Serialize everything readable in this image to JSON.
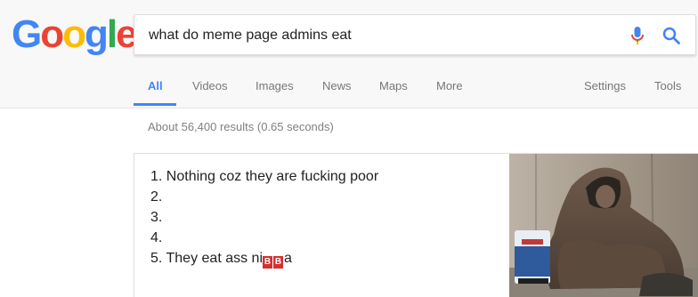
{
  "logo": {
    "letters": [
      "G",
      "o",
      "o",
      "g",
      "l",
      "e"
    ]
  },
  "search": {
    "query": "what do meme page admins eat",
    "mic_icon": "microphone-icon",
    "search_icon": "search-icon"
  },
  "tabs": [
    {
      "label": "All",
      "active": true
    },
    {
      "label": "Videos",
      "active": false
    },
    {
      "label": "Images",
      "active": false
    },
    {
      "label": "News",
      "active": false
    },
    {
      "label": "Maps",
      "active": false
    },
    {
      "label": "More",
      "active": false
    }
  ],
  "tools": {
    "settings": "Settings",
    "tools": "Tools"
  },
  "result_stats": "About 56,400 results (0.65 seconds)",
  "featured_snippet": {
    "items": [
      {
        "num": "1.",
        "text": "Nothing coz they are fucking poor"
      },
      {
        "num": "2.",
        "text": ""
      },
      {
        "num": "3.",
        "text": ""
      },
      {
        "num": "4.",
        "text": ""
      },
      {
        "num": "5.",
        "text_before": "They eat ass ni",
        "censored": [
          "B",
          "B"
        ],
        "text_after": "a"
      }
    ],
    "image_alt": "person in hooded coat sitting on pavement with shopping bag"
  },
  "colors": {
    "accent": "#4285f4",
    "censor": "#d23131",
    "mic_blue": "#4285f4",
    "mic_red": "#ea4335"
  }
}
